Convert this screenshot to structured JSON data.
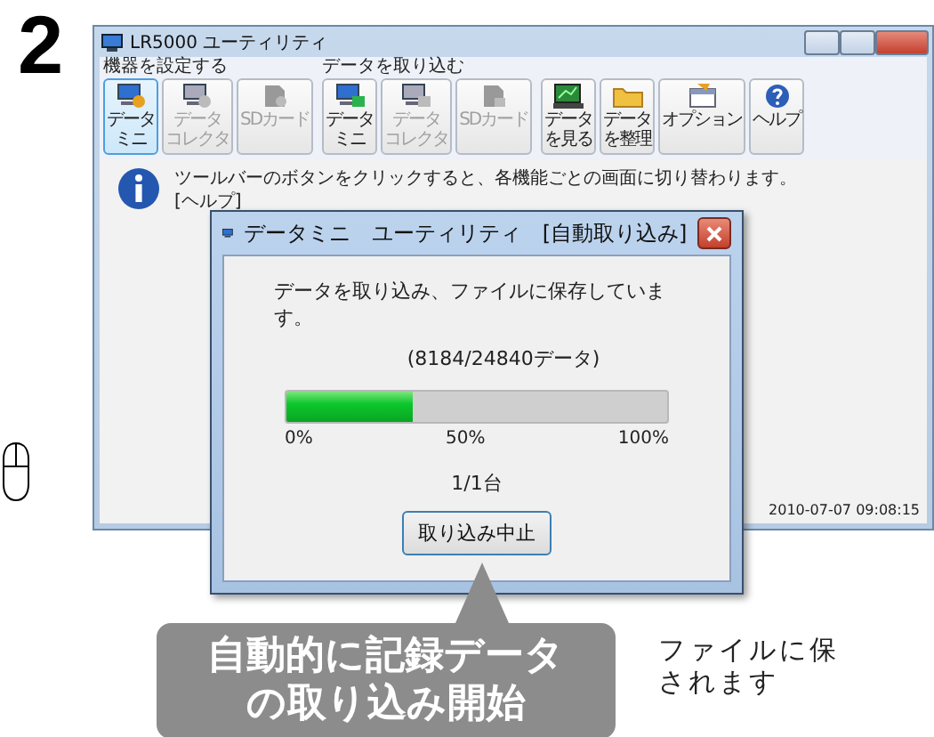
{
  "step_number": "2",
  "main_window": {
    "title": "LR5000 ユーティリティ",
    "toolbar_groups": [
      {
        "label": "機器を設定する",
        "buttons": [
          {
            "kind": "mini-setup",
            "lines": [
              "データ",
              "ミニ"
            ],
            "selected": true,
            "disabled": false
          },
          {
            "kind": "collector-setup",
            "lines": [
              "データ",
              "コレクタ"
            ],
            "selected": false,
            "disabled": true
          },
          {
            "kind": "sd-setup",
            "lines": [
              "SDカード"
            ],
            "selected": false,
            "disabled": true
          }
        ]
      },
      {
        "label": "データを取り込む",
        "buttons": [
          {
            "kind": "mini-import",
            "lines": [
              "データ",
              "ミニ"
            ],
            "selected": false,
            "disabled": false
          },
          {
            "kind": "collector-import",
            "lines": [
              "データ",
              "コレクタ"
            ],
            "selected": false,
            "disabled": true
          },
          {
            "kind": "sd-import",
            "lines": [
              "SDカード"
            ],
            "selected": false,
            "disabled": true
          }
        ]
      },
      {
        "buttons": [
          {
            "kind": "chart",
            "lines": [
              "データ",
              "を見る"
            ],
            "selected": false,
            "disabled": false
          },
          {
            "kind": "folder",
            "lines": [
              "データ",
              "を整理"
            ],
            "selected": false,
            "disabled": false
          },
          {
            "kind": "options",
            "lines": [
              "オプション"
            ],
            "selected": false,
            "disabled": false
          },
          {
            "kind": "help",
            "lines": [
              "ヘルプ"
            ],
            "selected": false,
            "disabled": false
          }
        ]
      }
    ],
    "info_lines": [
      "ツールバーのボタンをクリックすると、各機能ごとの画面に切り替わります。",
      "[ヘルプ]"
    ],
    "timestamp": "2010-07-07 09:08:15"
  },
  "dialog": {
    "title": "データミニ　ユーティリティ　[自動取り込み]",
    "message": "データを取り込み、ファイルに保存しています。",
    "count": "(8184/24840データ)",
    "level": 0.33,
    "ticks": [
      "0%",
      "50%",
      "100%"
    ],
    "units": "1/1台",
    "button": "取り込み中止"
  },
  "callout": {
    "lines": [
      "自動的に記録データ",
      "の取り込み開始"
    ]
  },
  "side_note": {
    "lines": [
      "ファイルに保",
      "されます"
    ]
  }
}
